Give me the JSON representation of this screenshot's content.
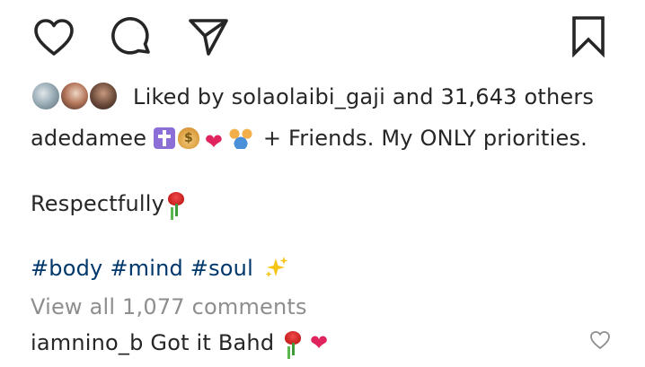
{
  "actions": {
    "like_icon": "heart-outline-icon",
    "comment_icon": "comment-bubble-icon",
    "share_icon": "paper-plane-icon",
    "save_icon": "bookmark-icon"
  },
  "likes": {
    "text": "Liked by solaolaibi_gaji and 31,643 others"
  },
  "caption": {
    "username": "adedamee",
    "emojis": [
      "latin-cross",
      "money-bag",
      "red-heart",
      "family"
    ],
    "text": "+ Friends. My ONLY priorities."
  },
  "caption_line2": {
    "text": "Respectfully"
  },
  "hashtags": [
    "#body",
    "#mind",
    "#soul"
  ],
  "view_comments": "View all 1,077 comments",
  "comment": {
    "username": "iamnino_b",
    "text": "Got it Bahd",
    "heart_glyph": "❤"
  },
  "colors": {
    "text": "#262626",
    "hashtag": "#00376b",
    "muted": "#8e8e8e",
    "heart": "#e0245e"
  }
}
